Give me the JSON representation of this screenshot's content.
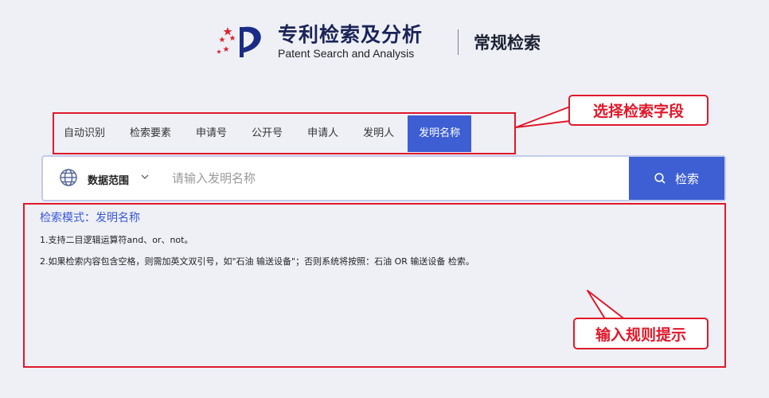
{
  "header": {
    "brand_cn": "专利检索及分析",
    "brand_en": "Patent Search and Analysis",
    "page_title": "常规检索"
  },
  "tabs": [
    {
      "label": "自动识别",
      "active": false
    },
    {
      "label": "检索要素",
      "active": false
    },
    {
      "label": "申请号",
      "active": false
    },
    {
      "label": "公开号",
      "active": false
    },
    {
      "label": "申请人",
      "active": false
    },
    {
      "label": "发明人",
      "active": false
    },
    {
      "label": "发明名称",
      "active": true
    }
  ],
  "search": {
    "scope_label": "数据范围",
    "placeholder": "请输入发明名称",
    "value": "",
    "button_label": "检索"
  },
  "hints": {
    "title": "检索模式：发明名称",
    "lines": [
      "1.支持二目逻辑运算符and、or、not。",
      "2.如果检索内容包含空格，则需加英文双引号，如\"石油 输送设备\"；否则系统将按照：石油 OR 输送设备 检索。"
    ]
  },
  "annotations": {
    "tabs_callout": "选择检索字段",
    "rules_callout": "输入规则提示"
  },
  "colors": {
    "accent": "#3d5fd3",
    "annotation_red": "#e0182a",
    "hint_title": "#3a58d6",
    "background": "#eef0f6"
  },
  "icons": {
    "logo": "patent-office-logo-icon",
    "scope": "globe-icon",
    "caret": "chevron-down-icon",
    "search": "search-icon"
  }
}
